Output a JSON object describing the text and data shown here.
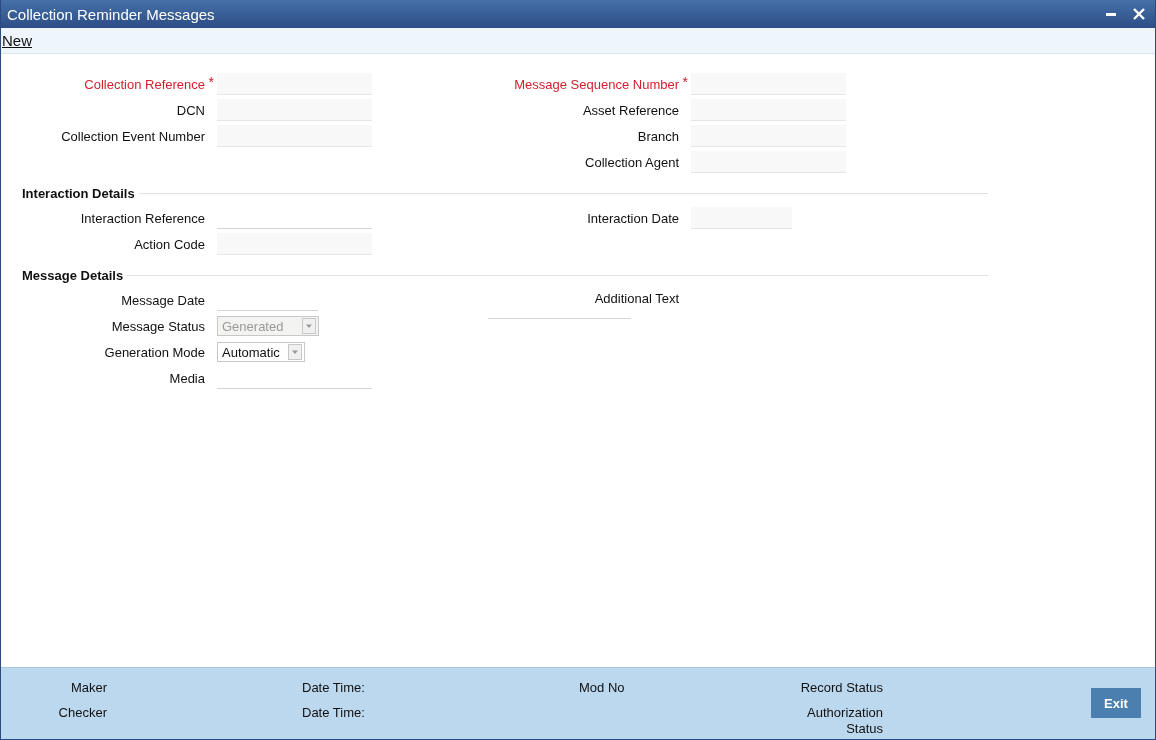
{
  "window": {
    "title": "Collection Reminder Messages"
  },
  "toolbar": {
    "new_link": "New"
  },
  "sections": [
    {
      "left": [
        {
          "label": "Collection Reference",
          "required": true,
          "mark": "*",
          "kind": "filled"
        },
        {
          "label": "DCN",
          "required": false,
          "kind": "filled"
        },
        {
          "label": "Collection Event Number",
          "required": false,
          "kind": "filled"
        }
      ],
      "right": [
        {
          "label": "Message Sequence Number",
          "required": true,
          "mark": "*",
          "kind": "filled"
        },
        {
          "label": "Asset Reference",
          "required": false,
          "kind": "filled"
        },
        {
          "label": "Branch",
          "required": false,
          "kind": "filled"
        },
        {
          "label": "Collection Agent",
          "required": false,
          "kind": "filled"
        }
      ]
    },
    {
      "title": "Interaction Details",
      "left": [
        {
          "label": "Interaction Reference",
          "required": false,
          "kind": "line"
        },
        {
          "label": "Action Code",
          "required": false,
          "kind": "filled"
        }
      ],
      "right": [
        {
          "label": "Interaction Date",
          "required": false,
          "kind": "filled-date"
        }
      ]
    },
    {
      "title": "Message Details",
      "left": [
        {
          "label": "Message Date",
          "required": false,
          "kind": "line-date"
        },
        {
          "label": "Message Status",
          "required": false,
          "kind": "select",
          "value": "Generated",
          "disabled": true
        },
        {
          "label": "Generation Mode",
          "required": false,
          "kind": "select",
          "value": "Automatic",
          "disabled": false
        },
        {
          "label": "Media",
          "required": false,
          "kind": "line"
        }
      ],
      "right": [
        {
          "label": "Additional Text",
          "required": false,
          "kind": "textarea"
        }
      ]
    }
  ],
  "footer": {
    "columns": [
      [
        "Maker",
        "Checker"
      ],
      [
        "Date Time:",
        "Date Time:"
      ],
      [
        "Mod No"
      ],
      [
        "Record Status",
        "Authorization Status"
      ]
    ],
    "exit_button": "Exit"
  }
}
